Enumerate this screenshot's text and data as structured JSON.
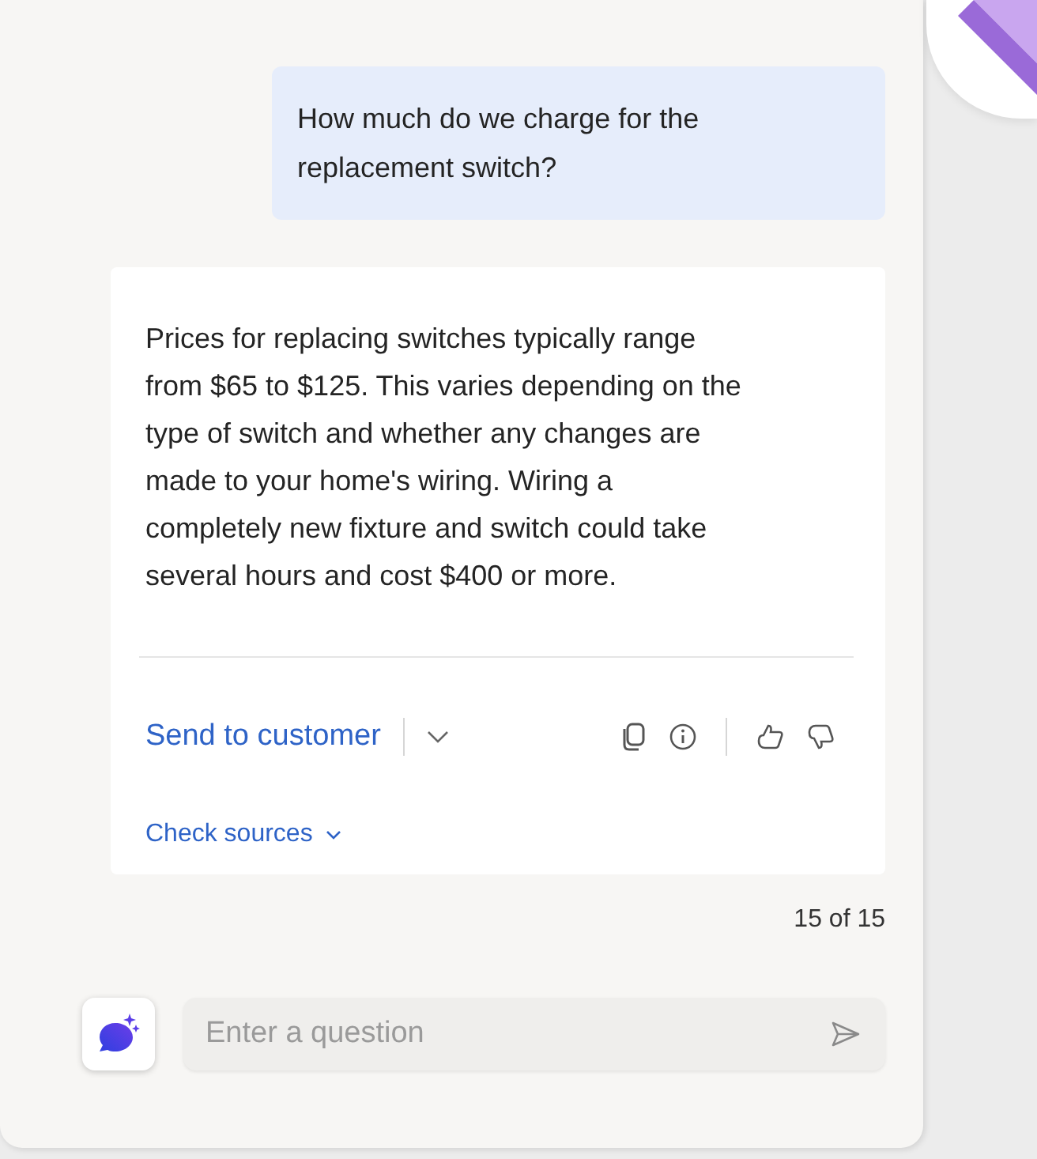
{
  "messages": [
    {
      "kind": "user",
      "text": "How much do we charge for the replacement switch?"
    },
    {
      "kind": "answer",
      "text": "Prices for replacing switches typically range from $65 to $125. This varies depending on the type of switch and whether any changes are made to your home's wiring. Wiring a completely new fixture and switch could take several hours and cost $400 or more.",
      "action": "Send to customer",
      "sources": "Check sources"
    }
  ],
  "counter": "15 of 15",
  "composer": {
    "placeholder": "Enter a question"
  }
}
